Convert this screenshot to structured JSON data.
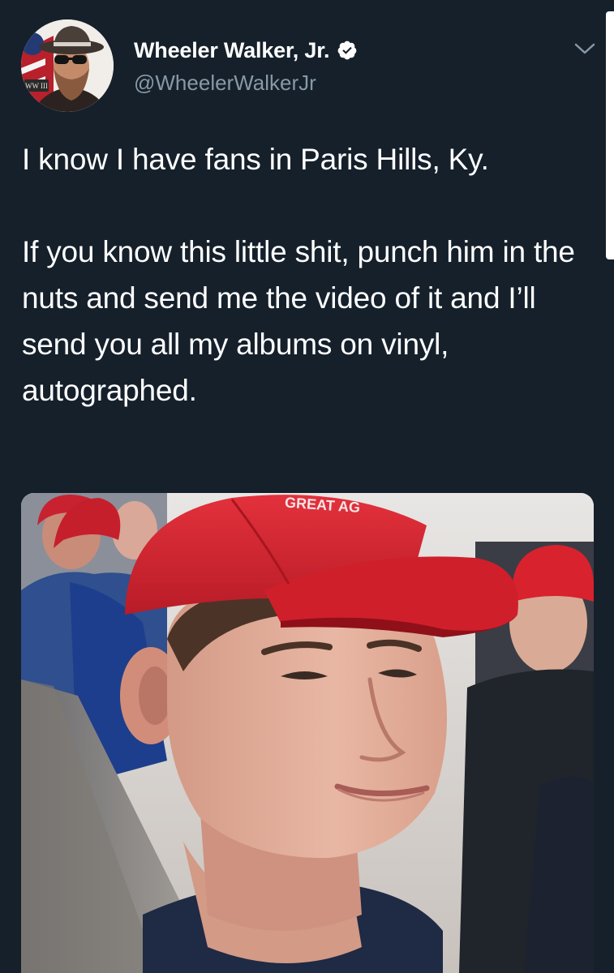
{
  "tweet": {
    "display_name": "Wheeler Walker, Jr.",
    "handle": "@WheelerWalkerJr",
    "verified": true,
    "text_paragraphs": [
      "I know I have fans in Paris Hills, Ky.",
      "If you know this little shit, punch him in the nuts and send me the video of it and I’ll send you all my albums on vinyl, autographed."
    ],
    "media": {
      "cap_text": "GREAT AG"
    }
  },
  "avatar": {
    "badge_text": "WW III"
  },
  "icons": {
    "verified": "verified-badge-icon",
    "menu": "chevron-down-icon"
  },
  "colors": {
    "background": "#15202b",
    "text": "#ffffff",
    "secondary_text": "#8899a6",
    "accent": "#1da1f2",
    "cap_red": "#d8222e"
  }
}
